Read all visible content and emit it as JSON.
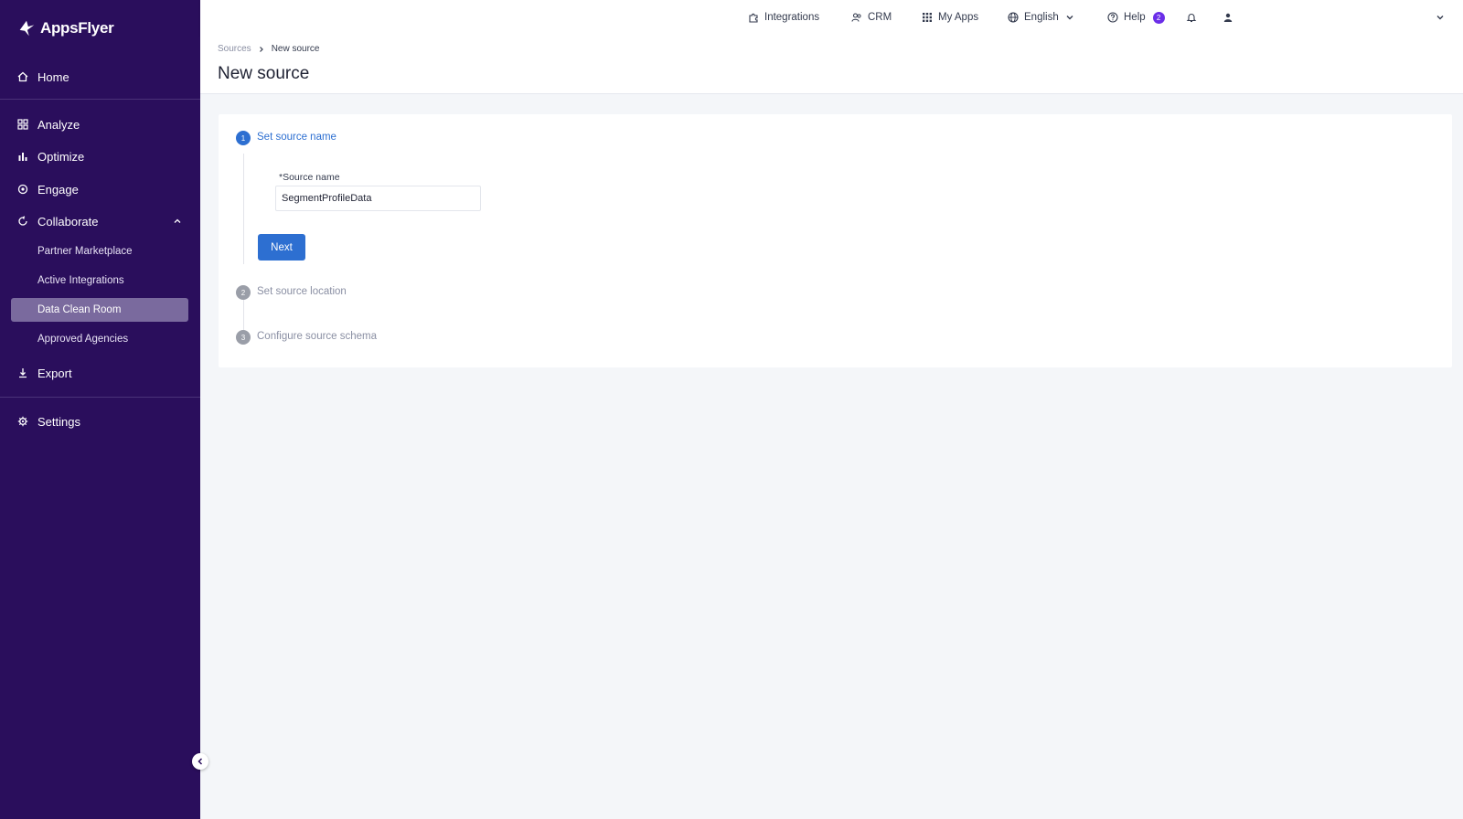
{
  "app": {
    "brand": "AppsFlyer"
  },
  "sidebar": {
    "items": [
      {
        "label": "Home",
        "icon": "home-icon"
      },
      {
        "label": "Analyze",
        "icon": "grid-icon"
      },
      {
        "label": "Optimize",
        "icon": "bar-chart-icon"
      },
      {
        "label": "Engage",
        "icon": "engage-icon"
      },
      {
        "label": "Collaborate",
        "icon": "sync-icon"
      },
      {
        "label": "Export",
        "icon": "export-icon"
      },
      {
        "label": "Settings",
        "icon": "gear-icon"
      }
    ],
    "collaborate_sub": [
      {
        "label": "Partner Marketplace"
      },
      {
        "label": "Active Integrations"
      },
      {
        "label": "Data Clean Room",
        "active": true
      },
      {
        "label": "Approved Agencies"
      }
    ]
  },
  "topbar": {
    "integrations": "Integrations",
    "crm": "CRM",
    "my_apps": "My Apps",
    "language": "English",
    "help": "Help",
    "help_badge": "2"
  },
  "header": {
    "breadcrumb_parent": "Sources",
    "breadcrumb_current": "New source",
    "title": "New source"
  },
  "wizard": {
    "steps": [
      {
        "number": "1",
        "label": "Set source name",
        "state": "active"
      },
      {
        "number": "2",
        "label": "Set source location",
        "state": "inactive"
      },
      {
        "number": "3",
        "label": "Configure source schema",
        "state": "inactive"
      }
    ],
    "field_label": "*Source name",
    "field_value": "SegmentProfileData",
    "next_label": "Next"
  },
  "colors": {
    "sidebar_bg": "#2a0e5c",
    "accent": "#2d6fd1",
    "active_sub_bg": "#7a6a9e",
    "badge": "#6b2ee8"
  }
}
